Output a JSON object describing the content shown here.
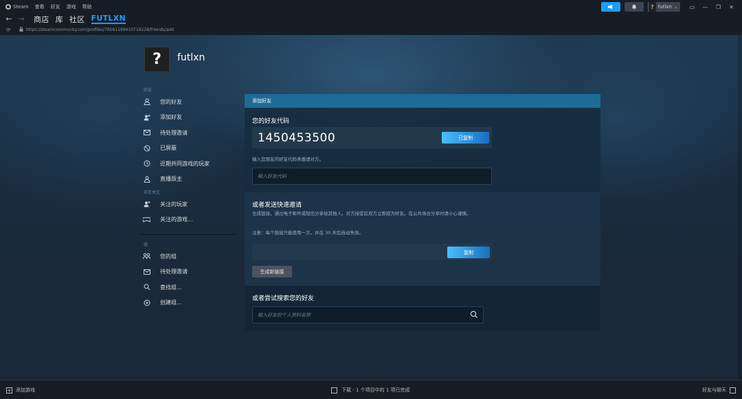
{
  "menu": {
    "app_name": "Steam",
    "items": [
      "查看",
      "好友",
      "游戏",
      "帮助"
    ]
  },
  "account": {
    "avatar_glyph": "?",
    "name": "futlxn"
  },
  "nav": {
    "tabs": [
      "商店",
      "库",
      "社区",
      "FUTLXN"
    ],
    "active_tab": "FUTLXN"
  },
  "url": "https://steamcommunity.com/profiles/76561199410719228/friends/add",
  "profile": {
    "avatar_glyph": "?",
    "name": "futlxn"
  },
  "sidebar": {
    "friends_section": "好友",
    "friends_items": [
      "您的好友",
      "添加好友",
      "待处理邀请",
      "已屏蔽",
      "近期共同游戏的玩家",
      "直播版主"
    ],
    "following_section": "正在关注",
    "following_items": [
      "关注的玩家",
      "关注的游戏..."
    ],
    "groups_section": "组",
    "groups_items": [
      "您的组",
      "待处理邀请",
      "查找组...",
      "创建组..."
    ]
  },
  "panel": {
    "header": "添加好友",
    "code_title": "您的好友代码",
    "friend_code": "1450453500",
    "copied_label": "已复制",
    "code_hint": "输入您朋友的好友代码来邀请对方。",
    "code_placeholder": "输入好友代码",
    "invite_title": "或者发送快速邀请",
    "invite_desc": "生成链接，通过电子邮件或短信分享给其他人。对方接受后双方立即成为好友。在公共场合分享时请小心谨慎。",
    "invite_note": "注意：每个链接只能使用一次，并在 30 天后自动失效。",
    "copy_label": "复制",
    "generate_label": "生成新链接",
    "search_title": "或者尝试搜索您的好友",
    "search_placeholder": "输入好友的个人资料名称"
  },
  "bottom": {
    "add_game": "添加游戏",
    "download_status": "下载 - 1 个项目中的 1 项已完成",
    "friends_chat": "好友与聊天"
  },
  "colors": {
    "accent": "#1a9fff",
    "panel_header": "#1d6b97",
    "background": "#1b2838"
  }
}
